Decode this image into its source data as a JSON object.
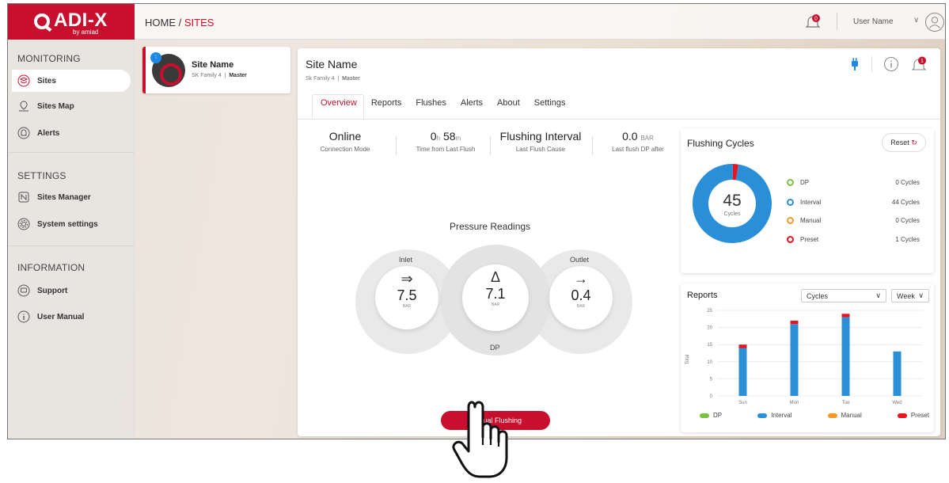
{
  "header": {
    "logo_name": "ADI-X",
    "logo_sub": "by amiad",
    "breadcrumb_home": "HOME",
    "breadcrumb_sep": " / ",
    "breadcrumb_current": "SITES",
    "notification_count": "0",
    "username": "User Name"
  },
  "sidebar": {
    "monitoring_title": "MONITORING",
    "settings_title": "SETTINGS",
    "information_title": "INFORMATION",
    "items": [
      {
        "label": "Sites",
        "icon": "layers-icon"
      },
      {
        "label": "Sites Map",
        "icon": "map-pin-icon"
      },
      {
        "label": "Alerts",
        "icon": "bell-icon"
      },
      {
        "label": "Sites Manager",
        "icon": "nfc-icon"
      },
      {
        "label": "System settings",
        "icon": "gear-icon"
      },
      {
        "label": "Support",
        "icon": "chat-icon"
      },
      {
        "label": "User Manual",
        "icon": "info-icon"
      }
    ]
  },
  "site_card": {
    "name": "Site Name",
    "family": "SK Family 4",
    "role": "Master"
  },
  "panel": {
    "title": "Site Name",
    "family": "Sk Family 4",
    "role": "Master",
    "alert_count": "1",
    "tabs": [
      "Overview",
      "Reports",
      "Flushes",
      "Alerts",
      "About",
      "Settings"
    ]
  },
  "stats": [
    {
      "value": "Online",
      "label": "Connection Mode"
    },
    {
      "value_h": "0",
      "unit_h": "h",
      "value_m": "58",
      "unit_m": "m",
      "label": "Time from Last Flush"
    },
    {
      "value": "Flushing Interval",
      "label": "Last Flush Cause"
    },
    {
      "value": "0.0",
      "unit": "BAR",
      "label": "Last flush DP after"
    }
  ],
  "pressure": {
    "title": "Pressure Readings",
    "inlet_label": "Inlet",
    "inlet_value": "7.5",
    "dp_label": "DP",
    "dp_value": "7.1",
    "outlet_label": "Outlet",
    "outlet_value": "0.4",
    "unit": "BAR"
  },
  "manual_flush_label": "Manual Flushing",
  "flushing_cycles": {
    "title": "Flushing Cycles",
    "reset_label": "Reset",
    "total": "45",
    "total_label": "Cycles",
    "legend": [
      {
        "name": "DP",
        "count": "0 Cycles",
        "color": "#7cc242"
      },
      {
        "name": "Interval",
        "count": "44 Cycles",
        "color": "#2a8fd6"
      },
      {
        "name": "Manual",
        "count": "0 Cycles",
        "color": "#f39a2b"
      },
      {
        "name": "Preset",
        "count": "1 Cycles",
        "color": "#e8141e"
      }
    ]
  },
  "reports": {
    "title": "Reports",
    "metric_select": "Cycles",
    "period_select": "Week",
    "ylabel": "Total"
  },
  "chart_data": {
    "type": "bar",
    "categories": [
      "Sun",
      "Mon",
      "Tue",
      "Wed"
    ],
    "ylim": [
      0,
      25
    ],
    "yticks": [
      0,
      5,
      10,
      15,
      20,
      25
    ],
    "ylabel": "Total",
    "series": [
      {
        "name": "DP",
        "color": "#7cc242",
        "values": [
          0,
          0,
          0,
          0
        ]
      },
      {
        "name": "Interval",
        "color": "#2a8fd6",
        "values": [
          14,
          21,
          23,
          13
        ]
      },
      {
        "name": "Manual",
        "color": "#f39a2b",
        "values": [
          0,
          0,
          0,
          0
        ]
      },
      {
        "name": "Preset",
        "color": "#e8141e",
        "values": [
          1,
          1,
          1,
          0
        ]
      }
    ]
  }
}
